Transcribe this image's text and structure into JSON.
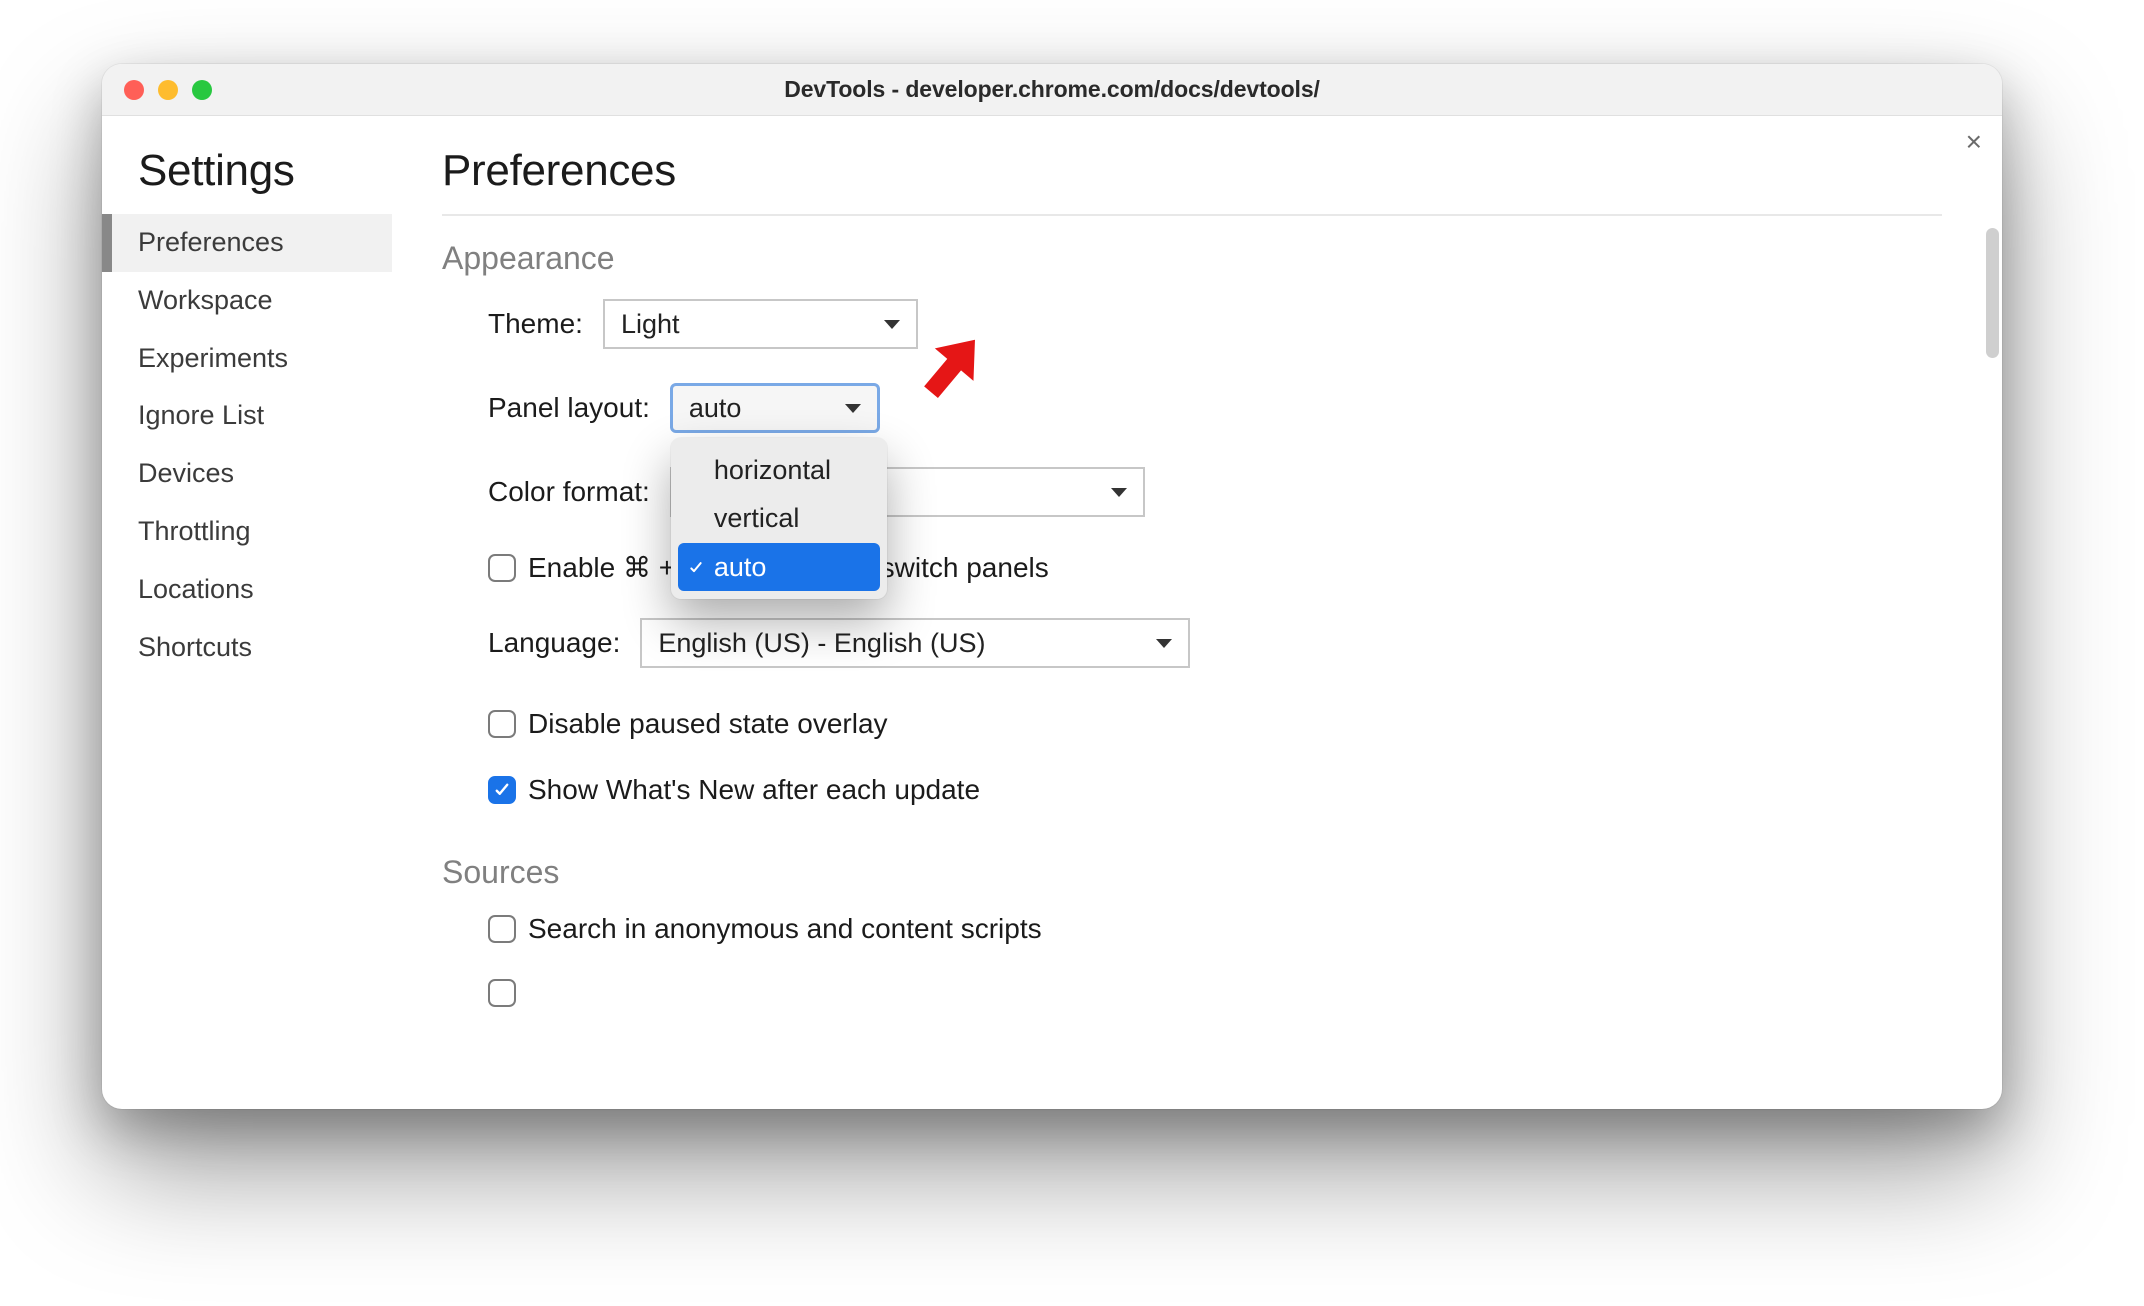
{
  "window": {
    "title": "DevTools - developer.chrome.com/docs/devtools/"
  },
  "close_label": "×",
  "sidebar": {
    "heading": "Settings",
    "items": [
      {
        "label": "Preferences",
        "selected": true
      },
      {
        "label": "Workspace",
        "selected": false
      },
      {
        "label": "Experiments",
        "selected": false
      },
      {
        "label": "Ignore List",
        "selected": false
      },
      {
        "label": "Devices",
        "selected": false
      },
      {
        "label": "Throttling",
        "selected": false
      },
      {
        "label": "Locations",
        "selected": false
      },
      {
        "label": "Shortcuts",
        "selected": false
      }
    ]
  },
  "page": {
    "title": "Preferences"
  },
  "appearance": {
    "section_title": "Appearance",
    "theme_label": "Theme:",
    "theme_value": "Light",
    "panel_layout_label": "Panel layout:",
    "panel_layout_value": "auto",
    "panel_layout_options": {
      "opt0": "horizontal",
      "opt1": "vertical",
      "opt2": "auto"
    },
    "color_format_label": "Color format:",
    "enable_shortcut_prefix": "Enable ⌘ + ",
    "enable_shortcut_suffix": " switch panels",
    "language_label": "Language:",
    "language_value": "English (US) - English (US)",
    "disable_paused_label": "Disable paused state overlay",
    "show_whats_new_label": "Show What's New after each update"
  },
  "sources": {
    "section_title": "Sources",
    "search_anon_label": "Search in anonymous and content scripts"
  }
}
